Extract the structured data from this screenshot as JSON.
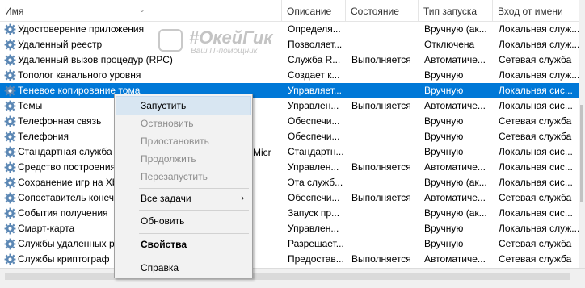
{
  "columns": [
    "Имя",
    "Описание",
    "Состояние",
    "Тип запуска",
    "Вход от имени"
  ],
  "colors": {
    "selection": "#0078d7",
    "menu_bg": "#f2f2f2",
    "menu_hover": "#d8e6f2",
    "gear": "#5b87b4"
  },
  "watermark": {
    "title": "#ОкейГик",
    "subtitle": "Ваш IT-помощник"
  },
  "rows": [
    {
      "name": "Удостоверение приложения",
      "desc": "Определя...",
      "state": "",
      "start": "Вручную (ак...",
      "logon": "Локальная служ..."
    },
    {
      "name": "Удаленный реестр",
      "desc": "Позволяет...",
      "state": "",
      "start": "Отключена",
      "logon": "Локальная служ..."
    },
    {
      "name": "Удаленный вызов процедур (RPC)",
      "desc": "Служба R...",
      "state": "Выполняется",
      "start": "Автоматиче...",
      "logon": "Сетевая служба"
    },
    {
      "name": "Тополог канального уровня",
      "desc": "Создает к...",
      "state": "",
      "start": "Вручную",
      "logon": "Локальная служ..."
    },
    {
      "name": "Теневое копирование тома",
      "desc": "Управляет...",
      "state": "",
      "start": "Вручную",
      "logon": "Локальная сис..."
    },
    {
      "name": "Темы",
      "desc": "Управлен...",
      "state": "Выполняется",
      "start": "Автоматиче...",
      "logon": "Локальная сис..."
    },
    {
      "name": "Телефонная связь",
      "desc": "Обеспечи...",
      "state": "",
      "start": "Вручную",
      "logon": "Сетевая служба"
    },
    {
      "name": "Телефония",
      "desc": "Обеспечи...",
      "state": "",
      "start": "Вручную",
      "logon": "Сетевая служба"
    },
    {
      "name": "Стандартная служба",
      "desc": "Стандартн...",
      "state": "",
      "start": "Вручную",
      "logon": "Локальная сис..."
    },
    {
      "name": "Средство построения",
      "desc": "Управлен...",
      "state": "Выполняется",
      "start": "Автоматиче...",
      "logon": "Локальная сис..."
    },
    {
      "name": "Сохранение игр на Xb",
      "desc": "Эта служб...",
      "state": "",
      "start": "Вручную (ак...",
      "logon": "Локальная сис..."
    },
    {
      "name": "Сопоставитель конеч",
      "desc": "Обеспечи...",
      "state": "Выполняется",
      "start": "Автоматиче...",
      "logon": "Сетевая служба"
    },
    {
      "name": "События получения",
      "desc": "Запуск пр...",
      "state": "",
      "start": "Вручную (ак...",
      "logon": "Локальная сис..."
    },
    {
      "name": "Смарт-карта",
      "desc": "Управлен...",
      "state": "",
      "start": "Вручную",
      "logon": "Локальная служ..."
    },
    {
      "name": "Службы удаленных р",
      "desc": "Разрешает...",
      "state": "",
      "start": "Вручную",
      "logon": "Сетевая служба"
    },
    {
      "name": "Службы криптограф",
      "desc": "Предостав...",
      "state": "Выполняется",
      "start": "Автоматиче...",
      "logon": "Сетевая служба"
    }
  ],
  "hidden_text_fragment": "Micr",
  "context_menu": {
    "start": "Запустить",
    "stop": "Остановить",
    "pause": "Приостановить",
    "resume": "Продолжить",
    "restart": "Перезапустить",
    "all_tasks": "Все задачи",
    "refresh": "Обновить",
    "properties": "Свойства",
    "help": "Справка"
  }
}
